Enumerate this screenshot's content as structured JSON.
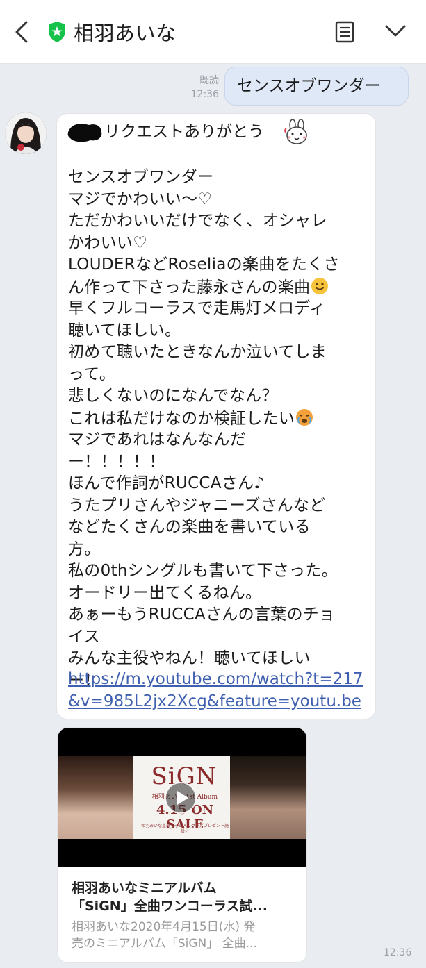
{
  "header": {
    "chat_title": "相羽あいな"
  },
  "sent_message": {
    "read_label": "既読",
    "time": "12:36",
    "text": "センスオブワンダー"
  },
  "received_message": {
    "first_line": "リクエストありがとう",
    "lines": [
      "センスオブワンダー",
      "マジでかわいい〜♡",
      "ただかわいいだけでなく、オシャレ",
      "かわいい♡",
      "LOUDERなどRoseliaの楽曲をたくさ",
      "ん作って下さった藤永さんの楽曲",
      "早くフルコーラスで走馬灯メロディ",
      "聴いてほしい。",
      "初めて聴いたときなんか泣いてしま",
      "って。",
      "悲しくないのになんでなん？",
      "これは私だけなのか検証したい",
      "マジであれはなんなんだ",
      "ー！！！！！",
      "ほんで作詞がRUCCAさん♪",
      "うたプリさんやジャニーズさんなど",
      "などたくさんの楽曲を書いている",
      "方。",
      "私の0thシングルも書いて下さった。",
      "オードリー出てくるねん。",
      "あぁーもうRUCCAさんの言葉のチョ",
      "イス",
      "みんな主役やねん！聴いてほしい",
      "ー！"
    ],
    "link_lines": [
      "https://m.youtube.com/watch?t=217",
      "&v=985L2jx2Xcg&feature=youtu.be"
    ],
    "time": "12:36"
  },
  "link_preview": {
    "thumbnail": {
      "logo": "SiGN",
      "subtitle": "相羽あいな 1st Album",
      "date": "4.15 ON SALE",
      "footnote": "相羽あいな直筆サイン入りグッズプレゼント施設分"
    },
    "title_lines": [
      "相羽あいなミニアルバム",
      "「SiGN」全曲ワンコーラス試..."
    ],
    "desc_lines": [
      "相羽あいな2020年4月15日(水) 発",
      "売のミニアルバム「SiGN」 全曲..."
    ]
  },
  "colors": {
    "background": "#e9ecf0",
    "sent_bubble": "#dfe8f7",
    "received_bubble": "#ffffff",
    "link": "#3f5fb0",
    "verified_shield": "#16c24a"
  },
  "icons": {
    "back": "back-icon",
    "verified": "shield-icon",
    "notes": "notes-icon",
    "menu": "chevron-down-icon",
    "play": "play-icon"
  }
}
